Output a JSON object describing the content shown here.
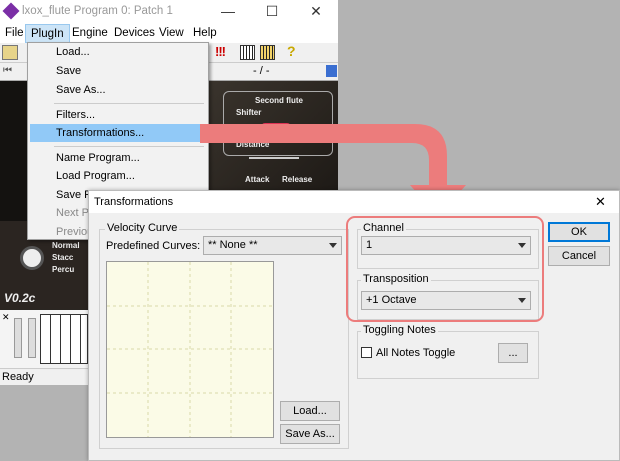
{
  "main_window": {
    "title": "lxox_flute Program 0: Patch  1",
    "buttons": {
      "minimize": "—",
      "maximize": "☐",
      "close": "✕"
    },
    "menu": [
      "File",
      "PlugIn",
      "Engine",
      "Devices",
      "View",
      "Help"
    ],
    "toolbar_text": "- / -",
    "status": "Ready"
  },
  "plugin_view": {
    "labels": {
      "second_flute": "Second flute",
      "shifter": "Shifter",
      "distance": "Distance",
      "attack": "Attack",
      "release": "Release",
      "normal": "Normal",
      "stacc": "Stacc",
      "percu": "Percu",
      "version": "V0.2c"
    }
  },
  "plugin_menu": {
    "items": [
      {
        "label": "Load...",
        "disabled": false
      },
      {
        "label": "Save",
        "disabled": false
      },
      {
        "label": "Save As...",
        "disabled": false
      },
      {
        "label": "Filters...",
        "disabled": false
      },
      {
        "label": "Transformations...",
        "disabled": false,
        "highlighted": true
      },
      {
        "label": "Name Program...",
        "disabled": false
      },
      {
        "label": "Load Program...",
        "disabled": false
      },
      {
        "label": "Save Pr",
        "disabled": false
      },
      {
        "label": "Next Pr",
        "disabled": true
      },
      {
        "label": "Previou",
        "disabled": true
      }
    ]
  },
  "dialog": {
    "title": "Transformations",
    "close": "✕",
    "velocity_curve": {
      "label": "Velocity Curve",
      "predefined_label": "Predefined Curves:",
      "predefined_value": "** None **",
      "load_button": "Load...",
      "save_as_button": "Save As..."
    },
    "channel": {
      "label": "Channel",
      "value": "1"
    },
    "transposition": {
      "label": "Transposition",
      "value": "+1 Octave"
    },
    "toggling_notes": {
      "label": "Toggling Notes",
      "checkbox_label": "All Notes Toggle",
      "checked": false,
      "browse_button": "..."
    },
    "ok_button": "OK",
    "cancel_button": "Cancel"
  },
  "colors": {
    "highlight_menu": "#91c9f7",
    "callout": "#ec7c7c",
    "curve_bg": "#fbfbe7",
    "grid_dash": "#d9d9a8"
  }
}
